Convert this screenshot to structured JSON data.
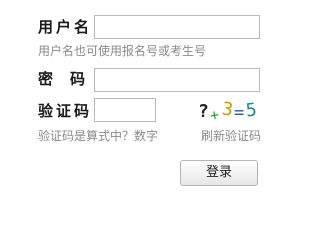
{
  "form": {
    "username_label": "用户名",
    "username_value": "",
    "username_hint": "用户名也可使用报名号或考生号",
    "password_label": "密　码",
    "password_value": "",
    "captcha_label": "验证码",
    "captcha_value": "",
    "captcha_hint": "验证码是算式中？数字",
    "refresh_label": "刷新验证码",
    "login_label": "登录"
  },
  "captcha_image": {
    "q": "?",
    "op": "+",
    "n": "3",
    "eq": "=",
    "result": "5"
  },
  "colors": {
    "captcha_q": "#222222",
    "captcha_op": "#2e9b2e",
    "captcha_n": "#c99a00",
    "captcha_eq": "#2255aa",
    "captcha_result": "#1f8a8a"
  }
}
